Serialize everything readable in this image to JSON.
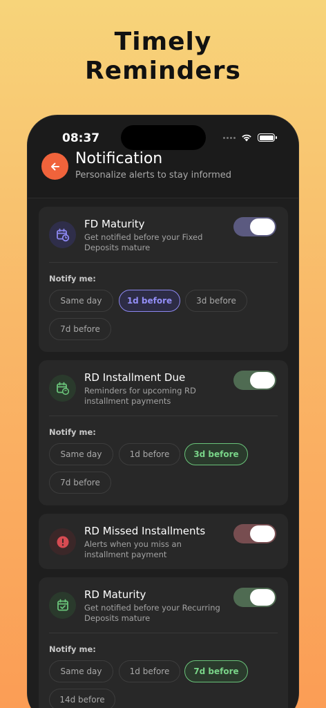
{
  "headline": {
    "line1": "Timely",
    "line2": "Reminders"
  },
  "status_bar": {
    "time": "08:37"
  },
  "header": {
    "title": "Notification",
    "subtitle": "Personalize alerts to stay informed"
  },
  "notify_label": "Notify me:",
  "colors": {
    "accent": "#f0633b",
    "purple": "#8d88f2",
    "green": "#6ac47a",
    "red": "#c0444a"
  },
  "cards": [
    {
      "title": "FD Maturity",
      "desc": "Get notified before your Fixed Deposits mature",
      "icon": "calendar-clock-icon",
      "enabled": true,
      "options": [
        "Same day",
        "1d before",
        "3d before",
        "7d before"
      ],
      "selected": "1d before"
    },
    {
      "title": "RD Installment Due",
      "desc": "Reminders for upcoming RD installment payments",
      "icon": "calendar-refresh-icon",
      "enabled": true,
      "options": [
        "Same day",
        "1d before",
        "3d before",
        "7d before"
      ],
      "selected": "3d before"
    },
    {
      "title": "RD Missed Installments",
      "desc": "Alerts when you miss an installment payment",
      "icon": "alert-icon",
      "enabled": true
    },
    {
      "title": "RD Maturity",
      "desc": "Get notified before your Recurring Deposits mature",
      "icon": "calendar-check-icon",
      "enabled": true,
      "options": [
        "Same day",
        "1d before",
        "7d before",
        "14d before"
      ],
      "selected": "7d before"
    }
  ]
}
